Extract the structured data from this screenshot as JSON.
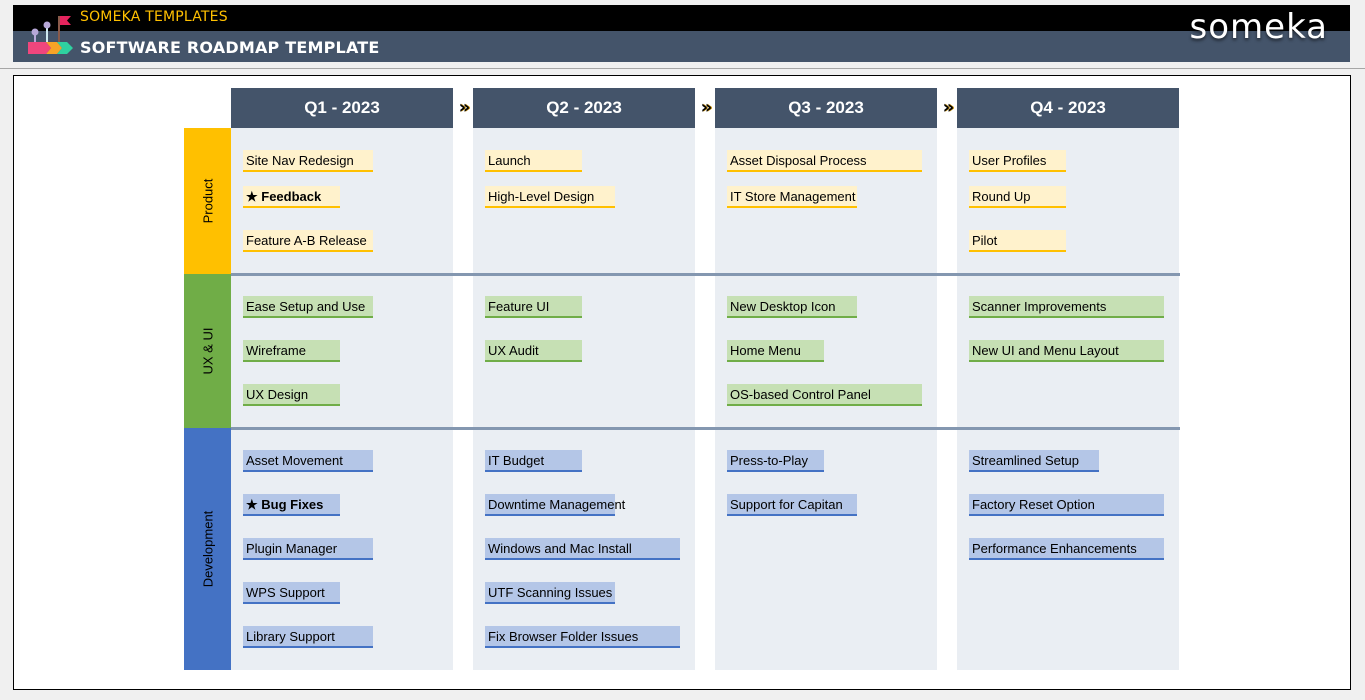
{
  "header": {
    "brand": "SOMEKA TEMPLATES",
    "title": "SOFTWARE ROADMAP TEMPLATE",
    "logo_text": "someka",
    "logo_icon": "roadmap-flag-icon"
  },
  "colors": {
    "header_dark": "#000000",
    "header_slate": "#44546a",
    "product": "#ffc000",
    "product_item": "#fff2cc",
    "ux": "#70ad47",
    "ux_item": "#c6e0b4",
    "development": "#4472c4",
    "development_item": "#b4c6e7",
    "column_bg": "#eaeef3",
    "separator": "#8497b0"
  },
  "quarters": [
    "Q1 - 2023",
    "Q2 - 2023",
    "Q3 - 2023",
    "Q4 - 2023"
  ],
  "chevron": "»",
  "categories": [
    {
      "name": "Product",
      "key": "product"
    },
    {
      "name": "UX & UI",
      "key": "ux"
    },
    {
      "name": "Development",
      "key": "development"
    }
  ],
  "items": {
    "product": [
      [
        {
          "label": "Site Nav Redesign"
        },
        {
          "label": "★ Feedback",
          "bold": true
        },
        {
          "label": "Feature A-B Release"
        }
      ],
      [
        {
          "label": "Launch"
        },
        {
          "label": "High-Level Design"
        }
      ],
      [
        {
          "label": "Asset Disposal Process"
        },
        {
          "label": "IT Store Management"
        }
      ],
      [
        {
          "label": "User Profiles"
        },
        {
          "label": "Round Up"
        },
        {
          "label": "Pilot"
        }
      ]
    ],
    "ux": [
      [
        {
          "label": "Ease Setup and Use"
        },
        {
          "label": "Wireframe"
        },
        {
          "label": "UX Design"
        }
      ],
      [
        {
          "label": "Feature UI"
        },
        {
          "label": "UX Audit"
        }
      ],
      [
        {
          "label": "New Desktop Icon"
        },
        {
          "label": "Home Menu"
        },
        {
          "label": "OS-based Control Panel"
        }
      ],
      [
        {
          "label": "Scanner Improvements"
        },
        {
          "label": "New UI and Menu Layout"
        }
      ]
    ],
    "development": [
      [
        {
          "label": "Asset Movement"
        },
        {
          "label": "★ Bug Fixes",
          "bold": true
        },
        {
          "label": "Plugin Manager"
        },
        {
          "label": "WPS Support"
        },
        {
          "label": "Library Support"
        }
      ],
      [
        {
          "label": "IT Budget"
        },
        {
          "label": "Downtime Management"
        },
        {
          "label": "Windows and Mac Install"
        },
        {
          "label": "UTF Scanning Issues"
        },
        {
          "label": "Fix Browser Folder Issues"
        }
      ],
      [
        {
          "label": "Press-to-Play"
        },
        {
          "label": "Support for Capitan"
        }
      ],
      [
        {
          "label": "Streamlined Setup"
        },
        {
          "label": "Factory Reset Option"
        },
        {
          "label": "Performance Enhancements"
        }
      ]
    ]
  }
}
